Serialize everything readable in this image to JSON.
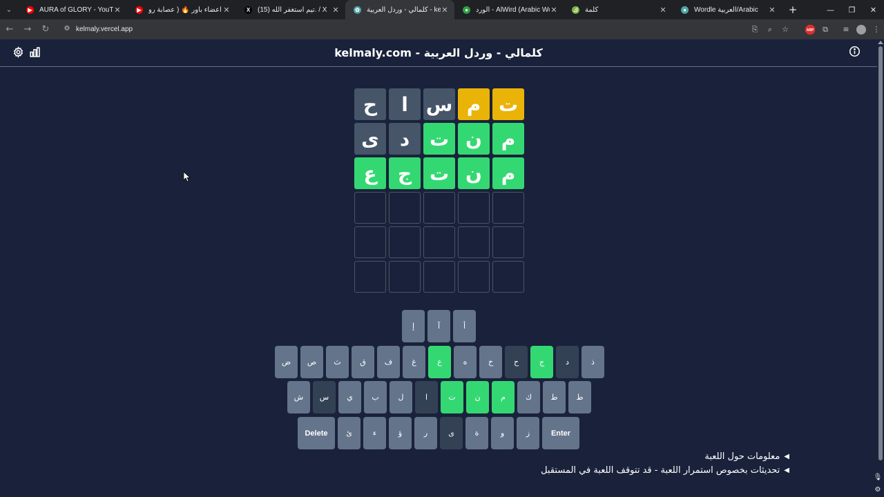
{
  "browser": {
    "tabs": [
      {
        "title": "AURA of GLORY - YouTube",
        "favicon_color": "#ff0000",
        "favicon_glyph": "▶",
        "active": false
      },
      {
        "title": "دلهمنا اعضاء باور 🔥 ( عصابة رو...",
        "favicon_color": "#ff0000",
        "favicon_glyph": "▶",
        "active": false
      },
      {
        "title": "(15) تيم استغفر الله. / X",
        "favicon_color": "#000000",
        "favicon_glyph": "X",
        "active": false
      },
      {
        "title": "كلمالي - وردل العربية - kelmaly.com",
        "favicon_color": "#4ea6a6",
        "favicon_glyph": "✿",
        "active": true
      },
      {
        "title": "الورد - AlWird (Arabic Wordle)",
        "favicon_color": "#2ea043",
        "favicon_glyph": "●",
        "active": false
      },
      {
        "title": "كلمة",
        "favicon_color": "#7cb342",
        "favicon_glyph": "ك",
        "active": false
      },
      {
        "title": "Wordle العربية/Arabic",
        "favicon_color": "#4ea6a6",
        "favicon_glyph": "●",
        "active": false
      }
    ],
    "url": "kelmaly.vercel.app",
    "ext_badge": "ABP"
  },
  "header": {
    "title": "kelmaly.com - كلمالي - وردل العربية"
  },
  "board": {
    "rows": [
      [
        {
          "l": "ت",
          "s": "present"
        },
        {
          "l": "م",
          "s": "present"
        },
        {
          "l": "س",
          "s": "absent"
        },
        {
          "l": "ا",
          "s": "absent"
        },
        {
          "l": "ح",
          "s": "absent"
        }
      ],
      [
        {
          "l": "م",
          "s": "correct"
        },
        {
          "l": "ن",
          "s": "correct"
        },
        {
          "l": "ت",
          "s": "correct"
        },
        {
          "l": "د",
          "s": "absent"
        },
        {
          "l": "ى",
          "s": "absent"
        }
      ],
      [
        {
          "l": "م",
          "s": "correct"
        },
        {
          "l": "ن",
          "s": "correct"
        },
        {
          "l": "ت",
          "s": "correct"
        },
        {
          "l": "ج",
          "s": "correct"
        },
        {
          "l": "ع",
          "s": "correct"
        }
      ],
      [
        {
          "l": "",
          "s": "empty"
        },
        {
          "l": "",
          "s": "empty"
        },
        {
          "l": "",
          "s": "empty"
        },
        {
          "l": "",
          "s": "empty"
        },
        {
          "l": "",
          "s": "empty"
        }
      ],
      [
        {
          "l": "",
          "s": "empty"
        },
        {
          "l": "",
          "s": "empty"
        },
        {
          "l": "",
          "s": "empty"
        },
        {
          "l": "",
          "s": "empty"
        },
        {
          "l": "",
          "s": "empty"
        }
      ],
      [
        {
          "l": "",
          "s": "empty"
        },
        {
          "l": "",
          "s": "empty"
        },
        {
          "l": "",
          "s": "empty"
        },
        {
          "l": "",
          "s": "empty"
        },
        {
          "l": "",
          "s": "empty"
        }
      ]
    ]
  },
  "keyboard": {
    "rows": [
      [
        {
          "k": "أ",
          "s": "key"
        },
        {
          "k": "آ",
          "s": "key"
        },
        {
          "k": "إ",
          "s": "key"
        }
      ],
      [
        {
          "k": "ذ",
          "s": "key"
        },
        {
          "k": "د",
          "s": "absent"
        },
        {
          "k": "ج",
          "s": "correct"
        },
        {
          "k": "ح",
          "s": "absent"
        },
        {
          "k": "خ",
          "s": "key"
        },
        {
          "k": "ه",
          "s": "key"
        },
        {
          "k": "ع",
          "s": "correct"
        },
        {
          "k": "غ",
          "s": "key"
        },
        {
          "k": "ف",
          "s": "key"
        },
        {
          "k": "ق",
          "s": "key"
        },
        {
          "k": "ث",
          "s": "key"
        },
        {
          "k": "ص",
          "s": "key"
        },
        {
          "k": "ض",
          "s": "key"
        }
      ],
      [
        {
          "k": "ط",
          "s": "key"
        },
        {
          "k": "ط",
          "s": "key"
        },
        {
          "k": "ك",
          "s": "key"
        },
        {
          "k": "م",
          "s": "correct"
        },
        {
          "k": "ن",
          "s": "correct"
        },
        {
          "k": "ت",
          "s": "correct"
        },
        {
          "k": "ا",
          "s": "absent"
        },
        {
          "k": "ل",
          "s": "key"
        },
        {
          "k": "ب",
          "s": "key"
        },
        {
          "k": "ي",
          "s": "key"
        },
        {
          "k": "س",
          "s": "absent"
        },
        {
          "k": "ش",
          "s": "key"
        }
      ],
      [
        {
          "k": "Enter",
          "s": "wide"
        },
        {
          "k": "ز",
          "s": "key"
        },
        {
          "k": "و",
          "s": "key"
        },
        {
          "k": "ة",
          "s": "key"
        },
        {
          "k": "ى",
          "s": "absent"
        },
        {
          "k": "ر",
          "s": "key"
        },
        {
          "k": "ؤ",
          "s": "key"
        },
        {
          "k": "ء",
          "s": "key"
        },
        {
          "k": "ئ",
          "s": "key"
        },
        {
          "k": "Delete",
          "s": "wide"
        }
      ]
    ]
  },
  "details": [
    "معلومات حول اللعبة",
    "تحديثات بخصوص استمرار اللعبة - قد تتوقف اللعبة في المستقبل"
  ],
  "colors": {
    "background": "#19223a",
    "correct": "#34d872",
    "present": "#eab308",
    "absent": "#475569",
    "key": "#64748b"
  }
}
